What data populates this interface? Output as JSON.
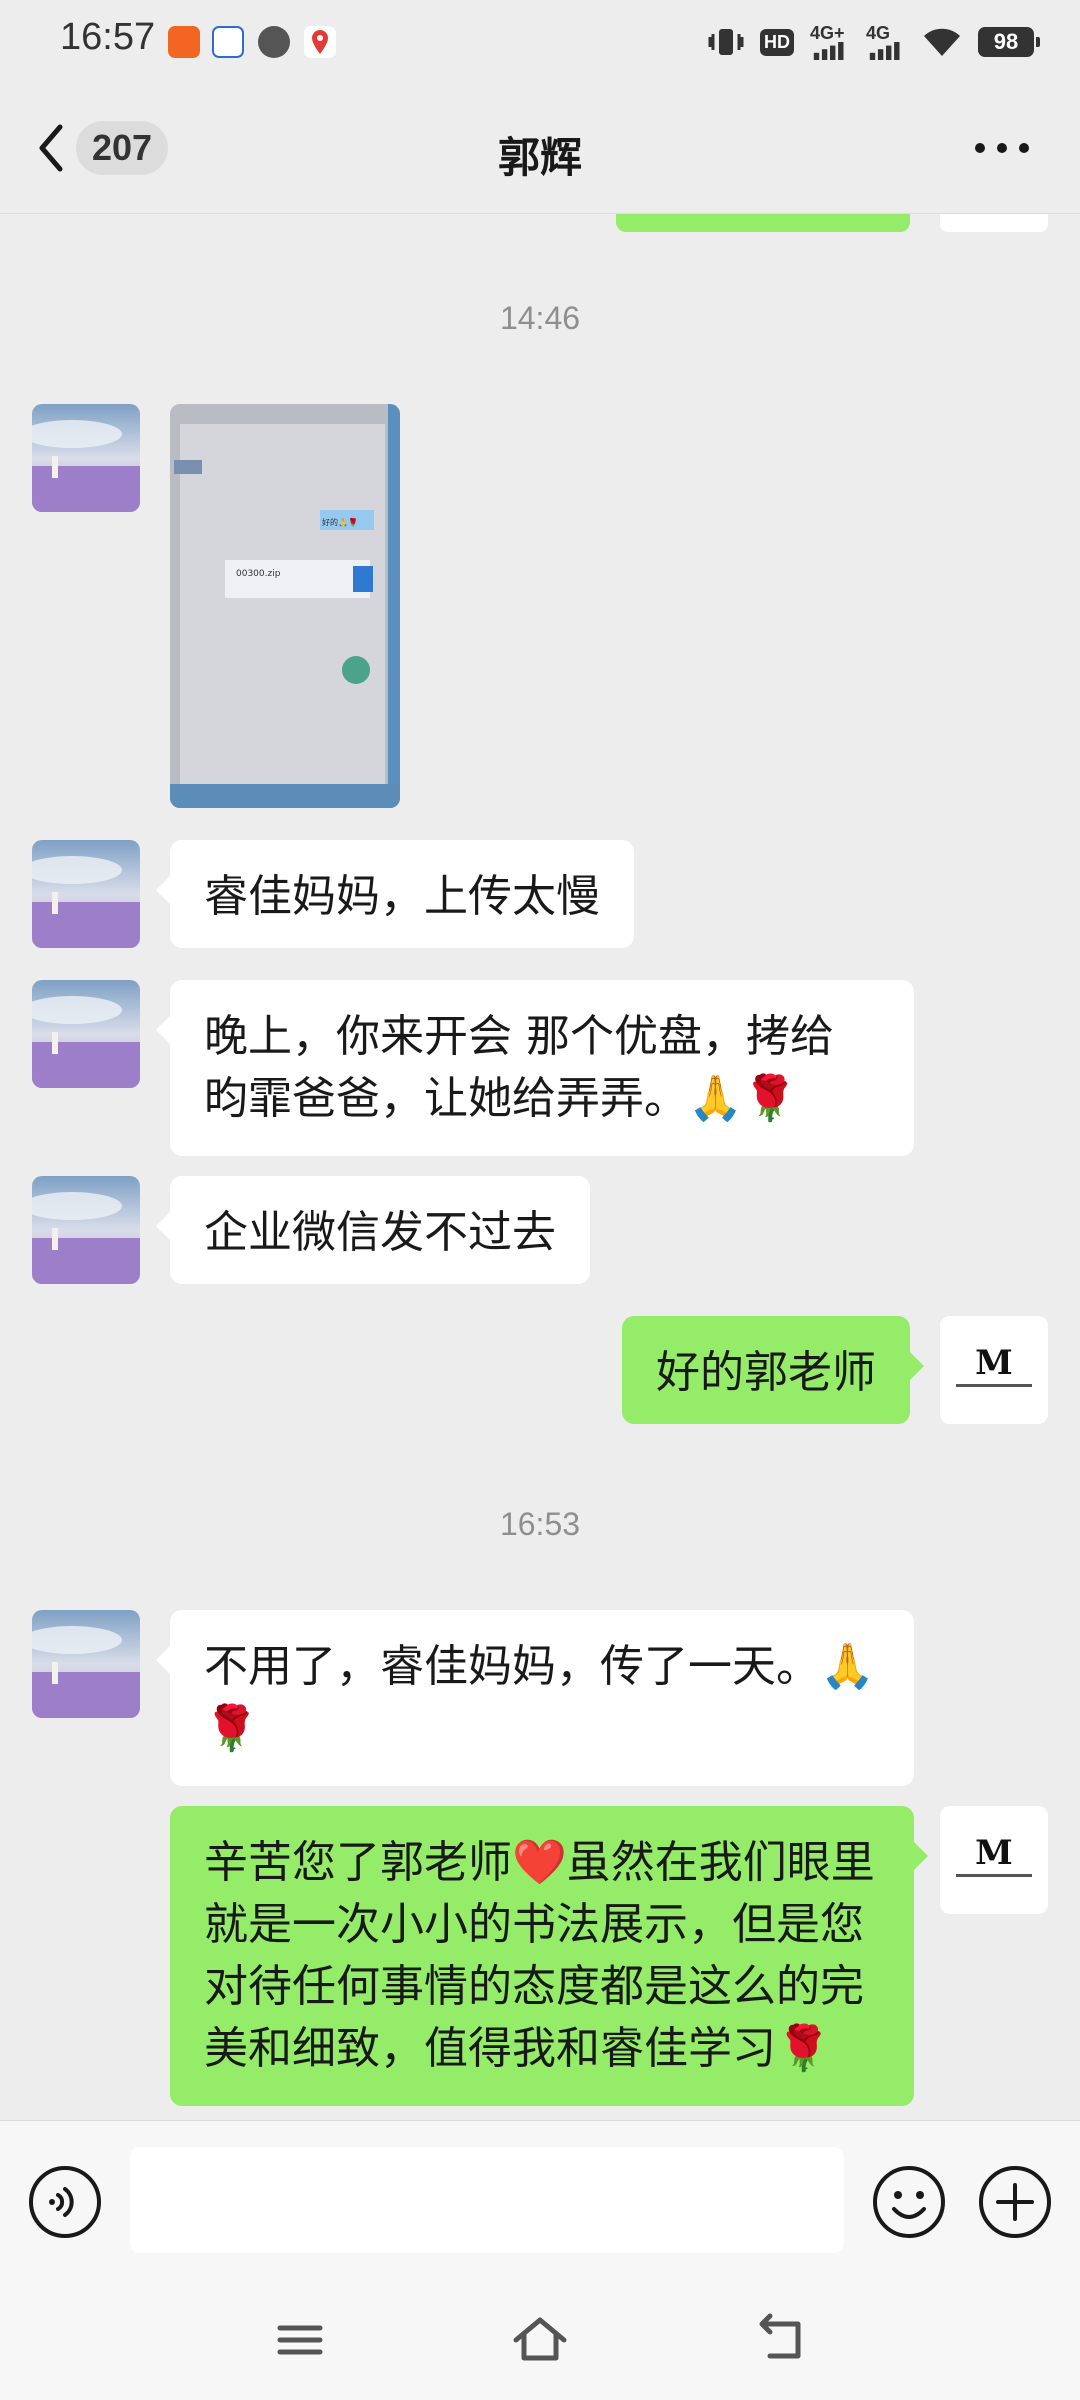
{
  "status_bar": {
    "time": "16:57",
    "network_1": "4G+",
    "network_2": "4G",
    "hd": "HD",
    "battery": "98"
  },
  "header": {
    "back_count": "207",
    "title": "郭辉"
  },
  "messages": [
    {
      "timestamp": "14:46"
    },
    {
      "text": "睿佳妈妈，上传太慢"
    },
    {
      "line1": "晚上，你来开会 那个优盘，拷给",
      "line2": "昀霏爸爸，让她给弄弄。🙏🌹"
    },
    {
      "text": "企业微信发不过去"
    },
    {
      "text": "好的郭老师"
    },
    {
      "timestamp": "16:53"
    },
    {
      "line1": "不用了，睿佳妈妈，传了一天。🙏",
      "line2": "🌹"
    },
    {
      "line1": "辛苦您了郭老师❤️虽然在我们眼里",
      "line2": "就是一次小小的书法展示，但是您",
      "line3": "对待任何事情的态度都是这么的完",
      "line4": "美和细致，值得我和睿佳学习🌹"
    }
  ],
  "image_message": {
    "file_name": "00300.zip",
    "note": "好的🙏🌹"
  },
  "my_avatar_text": "M",
  "input": {
    "value": "",
    "placeholder": ""
  },
  "colors": {
    "bubble_out": "#95ec69",
    "bubble_in": "#ffffff",
    "background": "#ededed"
  },
  "icons": [
    "back-chevron-icon",
    "more-icon",
    "voice-icon",
    "emoji-icon",
    "plus-icon",
    "menu-icon",
    "home-icon",
    "back-icon"
  ]
}
